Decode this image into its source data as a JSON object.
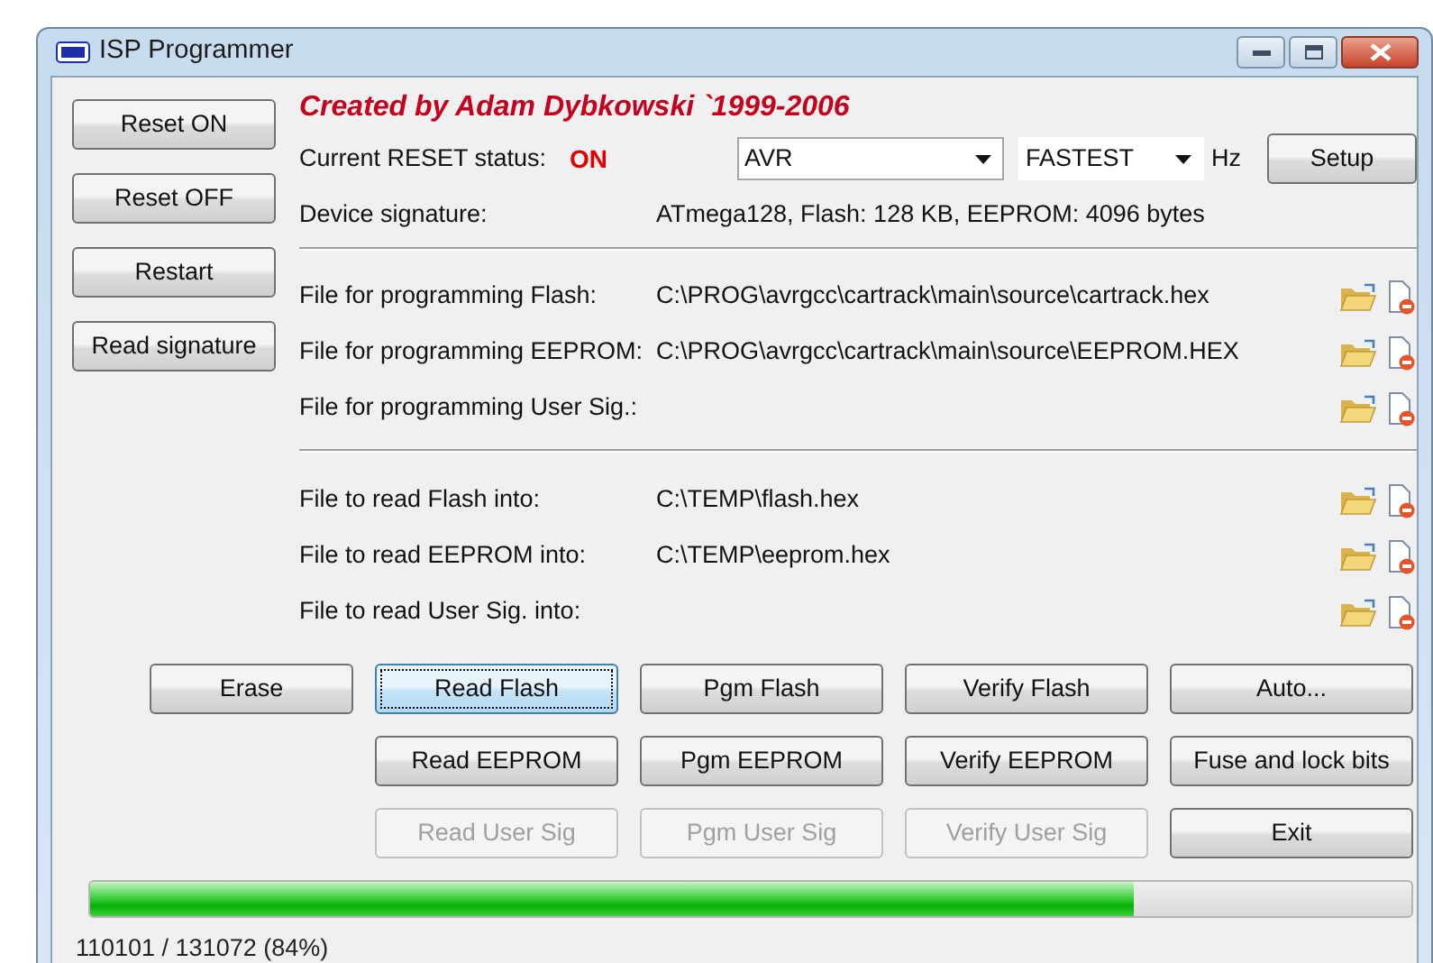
{
  "window": {
    "title": "ISP Programmer"
  },
  "side_buttons": [
    {
      "label": "Reset ON"
    },
    {
      "label": "Reset OFF"
    },
    {
      "label": "Restart"
    },
    {
      "label": "Read signature"
    }
  ],
  "credit": "Created by Adam Dybkowski `1999-2006",
  "reset_status": {
    "label": "Current RESET status:",
    "value": "ON"
  },
  "device_select": {
    "value": "AVR"
  },
  "speed_select": {
    "value": "FASTEST"
  },
  "speed_unit": "Hz",
  "setup_button": "Setup",
  "signature": {
    "label": "Device signature:",
    "value": "ATmega128, Flash: 128 KB, EEPROM: 4096 bytes"
  },
  "file_groups": [
    {
      "rows": [
        {
          "label": "File for programming Flash:",
          "path": "C:\\PROG\\avrgcc\\cartrack\\main\\source\\cartrack.hex"
        },
        {
          "label": "File for programming EEPROM:",
          "path": "C:\\PROG\\avrgcc\\cartrack\\main\\source\\EEPROM.HEX"
        },
        {
          "label": "File for programming User Sig.:"
        }
      ]
    },
    {
      "rows": [
        {
          "label": "File to read Flash into:",
          "path": "C:\\TEMP\\flash.hex"
        },
        {
          "label": "File to read EEPROM into:",
          "path": "C:\\TEMP\\eeprom.hex"
        },
        {
          "label": "File to read User Sig. into:"
        }
      ]
    }
  ],
  "action_rows": [
    [
      {
        "label": "Erase",
        "disabled": false,
        "focused": false
      },
      {
        "label": "Read Flash",
        "disabled": false,
        "focused": true
      },
      {
        "label": "Pgm Flash",
        "disabled": false,
        "focused": false
      },
      {
        "label": "Verify Flash",
        "disabled": false,
        "focused": false
      },
      {
        "label": "Auto...",
        "disabled": false,
        "focused": false
      }
    ],
    [
      {
        "label": "Read EEPROM",
        "disabled": false,
        "focused": false
      },
      {
        "label": "Pgm EEPROM",
        "disabled": false,
        "focused": false
      },
      {
        "label": "Verify EEPROM",
        "disabled": false,
        "focused": false
      },
      {
        "label": "Fuse and lock bits",
        "disabled": false,
        "focused": false
      }
    ],
    [
      {
        "label": "Read User Sig",
        "disabled": true,
        "focused": false
      },
      {
        "label": "Pgm User Sig",
        "disabled": true,
        "focused": false
      },
      {
        "label": "Verify User Sig",
        "disabled": true,
        "focused": false
      },
      {
        "label": "Exit",
        "disabled": false,
        "focused": false
      }
    ]
  ],
  "progress": {
    "level": 0.79
  },
  "status_bar": "110101 / 131072 (84%)"
}
